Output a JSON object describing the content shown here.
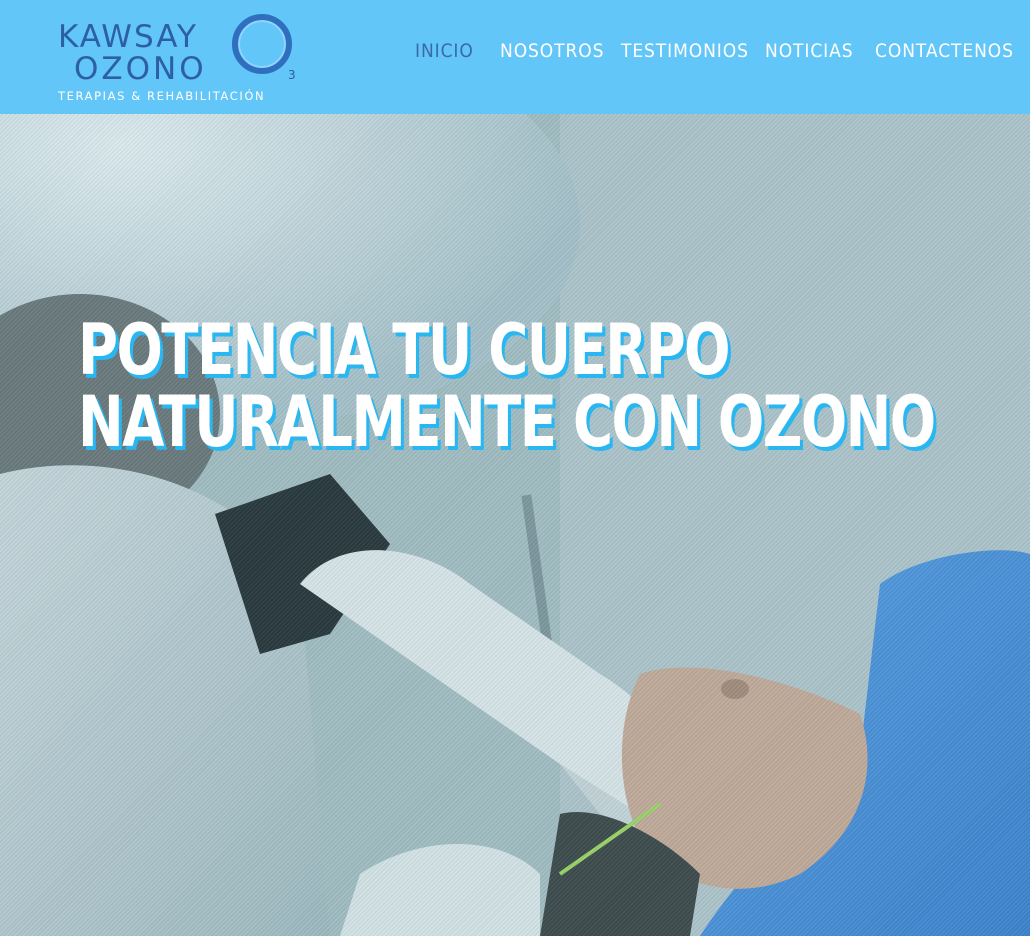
{
  "brand": {
    "name_line1": "KAWSAY",
    "name_line2": "OZONO",
    "subscript": "3",
    "tagline": "TERAPIAS & REHABILITACIÓN"
  },
  "nav": {
    "items": [
      {
        "label": "INICIO",
        "active": true
      },
      {
        "label": "NOSOTROS",
        "active": false
      },
      {
        "label": "TESTIMONIOS",
        "active": false
      },
      {
        "label": "NOTICIAS",
        "active": false
      },
      {
        "label": "CONTACTENOS",
        "active": false
      }
    ]
  },
  "hero": {
    "title_line1": "POTENCIA TU CUERPO",
    "title_line2": "NATURALMENTE CON OZONO"
  },
  "colors": {
    "header_bg": "#62c6f8",
    "brand_blue": "#2c5fa6",
    "nav_active": "#3a6aa8",
    "title_shadow": "#2ab6f0"
  },
  "icons": {
    "logo_mark": "ozone-ring-icon"
  }
}
